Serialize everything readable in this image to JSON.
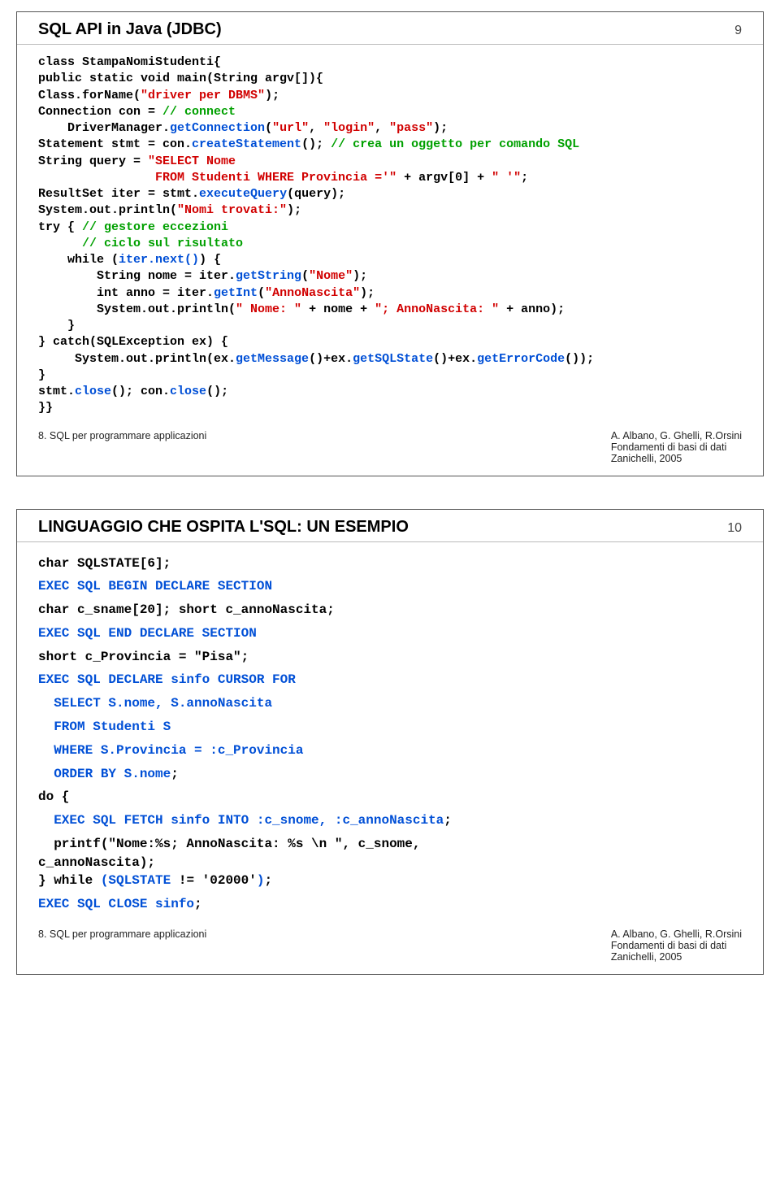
{
  "slide1": {
    "title": "SQL API in Java (JDBC)",
    "number": "9",
    "c": {
      "l01a": "class StampaNomiStudenti{",
      "l02a": "public static void main(String argv[]){",
      "l03a": "Class.forName(",
      "l03b": "\"driver per DBMS\"",
      "l03c": ");",
      "l04a": "Connection con = ",
      "l04b": "// connect",
      "l05a": "    DriverManager.",
      "l05b": "getConnection",
      "l05c": "(",
      "l05d": "\"url\"",
      "l05e": ", ",
      "l05f": "\"login\"",
      "l05g": ", ",
      "l05h": "\"pass\"",
      "l05i": ");",
      "l06a": "Statement stmt = con.",
      "l06b": "createStatement",
      "l06c": "(); ",
      "l06d": "// crea un oggetto per comando SQL",
      "l07a": "String query = ",
      "l07b": "\"SELECT Nome",
      "l08a": "                FROM Studenti WHERE Provincia ='\"",
      "l08b": " + argv[0] + ",
      "l08c": "\" '\"",
      "l08d": ";",
      "l09a": "ResultSet iter = stmt.",
      "l09b": "executeQuery",
      "l09c": "(query);",
      "l10a": "System.out.println(",
      "l10b": "\"Nomi trovati:\"",
      "l10c": ");",
      "l11a": "try { ",
      "l11b": "// gestore eccezioni",
      "l12a": "      ",
      "l12b": "// ciclo sul risultato",
      "l13a": "    while (",
      "l13b": "iter.next()",
      "l13c": ") {",
      "l14a": "        String nome = iter.",
      "l14b": "getString",
      "l14c": "(",
      "l14d": "\"Nome\"",
      "l14e": ");",
      "l15a": "        int anno = iter.",
      "l15b": "getInt",
      "l15c": "(",
      "l15d": "\"AnnoNascita\"",
      "l15e": ");",
      "l16a": "        System.out.println(",
      "l16b": "\" Nome: \"",
      "l16c": " + nome + ",
      "l16d": "\"; AnnoNascita: \"",
      "l16e": " + anno);",
      "l17a": "    }",
      "l18a": "} catch(SQLException ex) {",
      "l19a": "     System.out.println(ex.",
      "l19b": "getMessage",
      "l19c": "()+ex.",
      "l19d": "getSQLState",
      "l19e": "()+ex.",
      "l19f": "getErrorCode",
      "l19g": "());",
      "l20a": "}",
      "l21a": "stmt.",
      "l21b": "close",
      "l21c": "(); con.",
      "l21d": "close",
      "l21e": "();",
      "l22a": "}}"
    }
  },
  "slide2": {
    "title": "LINGUAGGIO CHE OSPITA L'SQL: UN ESEMPIO",
    "number": "10",
    "c": {
      "l01a": "char SQLSTATE[6];",
      "l02a": "EXEC SQL BEGIN DECLARE SECTION",
      "l03a": "char c_sname[20]; short c_annoNascita;",
      "l04a": "EXEC SQL END DECLARE SECTION",
      "l05a": "short c_Provincia = \"Pisa\";",
      "l06a": "EXEC SQL DECLARE sinfo CURSOR FOR",
      "l07a": "  SELECT S.nome, S.annoNascita",
      "l08a": "  FROM Studenti S",
      "l09a": "  WHERE S.Provincia = :c_Provincia",
      "l10a": "  ORDER BY S.nome",
      "l10b": ";",
      "l11a": "do {",
      "l12a": "  EXEC SQL FETCH sinfo INTO :c_snome, :c_annoNascita",
      "l12b": ";",
      "l13a": "  printf(\"Nome:%s; AnnoNascita: %s \\n \", c_snome,",
      "l13b": "c_annoNascita);",
      "l14a": "} while ",
      "l14b": "(",
      "l14c": "SQLSTATE ",
      "l14d": "!= '02000'",
      "l14e": ")",
      "l14f": ";",
      "l15a": "EXEC SQL CLOSE sinfo",
      "l15b": ";"
    }
  },
  "footer": {
    "left": "8. SQL per programmare applicazioni",
    "r1": "A. Albano, G. Ghelli, R.Orsini",
    "r2": "Fondamenti di basi di dati",
    "r3": "Zanichelli, 2005"
  }
}
